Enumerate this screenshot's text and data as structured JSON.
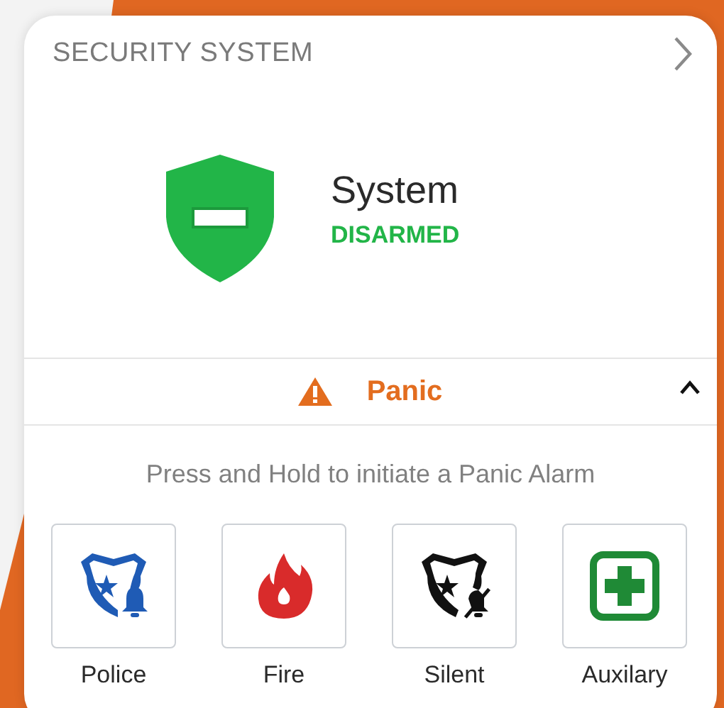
{
  "card": {
    "title": "SECURITY SYSTEM"
  },
  "system": {
    "label": "System",
    "state": "DISARMED",
    "kind": "disarmed"
  },
  "panic": {
    "title": "Panic",
    "expanded": true,
    "hint": "Press and Hold to initiate a Panic Alarm",
    "buttons": [
      {
        "label": "Police",
        "kind": "police"
      },
      {
        "label": "Fire",
        "kind": "fire"
      },
      {
        "label": "Silent",
        "kind": "silent"
      },
      {
        "label": "Auxilary",
        "kind": "auxiliary"
      }
    ]
  }
}
